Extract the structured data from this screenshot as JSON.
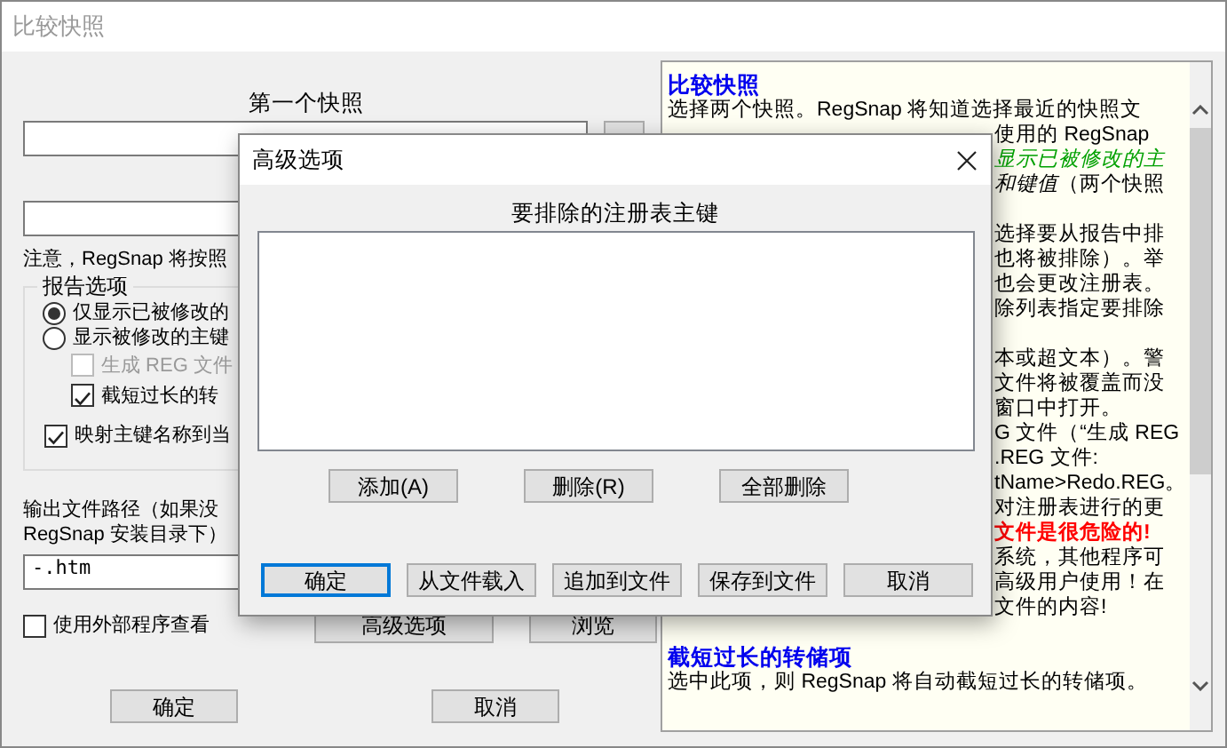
{
  "window": {
    "title": "比较快照"
  },
  "main": {
    "first_snapshot_label": "第一个快照",
    "note": "注意，RegSnap 将按照",
    "report_options": {
      "title": "报告选项",
      "radios": [
        {
          "label": "仅显示已被修改的",
          "selected": true
        },
        {
          "label": "显示被修改的主键",
          "selected": false,
          "children": [
            {
              "label": "生成 REG 文件",
              "checked": false,
              "disabled": true
            },
            {
              "label": "截短过长的转",
              "checked": true,
              "disabled": false
            }
          ]
        }
      ],
      "checkboxes": [
        {
          "label": "映射主键名称到当",
          "checked": true,
          "disabled": false
        }
      ]
    },
    "output_path_label": [
      "输出文件路径（如果没",
      "RegSnap 安装目录下）"
    ],
    "output_path": {
      "value": "-.htm"
    },
    "external_viewer": {
      "label": "使用外部程序查看",
      "checked": false
    },
    "buttons": [
      "高级选项",
      "浏览"
    ],
    "footer_buttons": [
      "确定",
      "取消"
    ]
  },
  "help": {
    "paragraphs": [
      {
        "lines": [
          {
            "kind": "heading",
            "text": "比较快照",
            "clipped": false
          },
          {
            "kind": "text",
            "text": "选择两个快照。RegSnap 将知道选择最近的快照文",
            "clipped": false
          },
          {
            "kind": "text",
            "text": "使用的 RegSnap",
            "clipped": true
          },
          {
            "kind": "option",
            "text": "显示已被修改的主",
            "clipped": true
          },
          {
            "kind": "text",
            "text": "*和键值*（两个快照",
            "clipped": true
          }
        ]
      },
      {
        "lines": [
          {
            "kind": "text",
            "text": "选择要从报告中排",
            "clipped": true
          },
          {
            "kind": "text",
            "text": "也将被排除）。举",
            "clipped": true
          },
          {
            "kind": "text",
            "text": "也会更改注册表。",
            "clipped": true
          },
          {
            "kind": "text",
            "text": "除列表指定要排除",
            "clipped": true
          }
        ]
      },
      {
        "lines": [
          {
            "kind": "text",
            "text": "本或超文本）。警",
            "clipped": true
          },
          {
            "kind": "text",
            "text": "文件将被覆盖而没",
            "clipped": true
          },
          {
            "kind": "text",
            "text": "窗口中打开。",
            "clipped": true
          },
          {
            "kind": "text",
            "text": "G 文件（“生成 REG",
            "clipped": true
          },
          {
            "kind": "text",
            "text": ".REG 文件:",
            "clipped": true
          },
          {
            "kind": "text",
            "text": "tName>Redo.REG。",
            "clipped": true
          },
          {
            "kind": "text",
            "text": "对注册表进行的更",
            "clipped": true
          },
          {
            "kind": "warning",
            "text": "文件是很危险的!",
            "clipped": true
          },
          {
            "kind": "text",
            "text": "系统，其他程序可",
            "clipped": true
          },
          {
            "kind": "text",
            "text": "高级用户使用！在",
            "clipped": true
          },
          {
            "kind": "text",
            "text": "文件的内容!",
            "clipped": true
          }
        ]
      },
      {
        "lines": [
          {
            "kind": "heading",
            "text": "截短过长的转储项",
            "clipped": false
          },
          {
            "kind": "text",
            "text": "选中此项，则 RegSnap 将自动截短过长的转储项。",
            "clipped": false
          }
        ]
      }
    ]
  },
  "dialog": {
    "title": "高级选项",
    "list_label": "要排除的注册表主键",
    "list_buttons": [
      "添加(A)",
      "删除(R)",
      "全部删除"
    ],
    "buttons": [
      {
        "label": "确定",
        "focused": true
      },
      {
        "label": "从文件载入",
        "focused": false
      },
      {
        "label": "追加到文件",
        "focused": false
      },
      {
        "label": "保存到文件",
        "focused": false
      },
      {
        "label": "取消",
        "focused": false
      }
    ]
  }
}
